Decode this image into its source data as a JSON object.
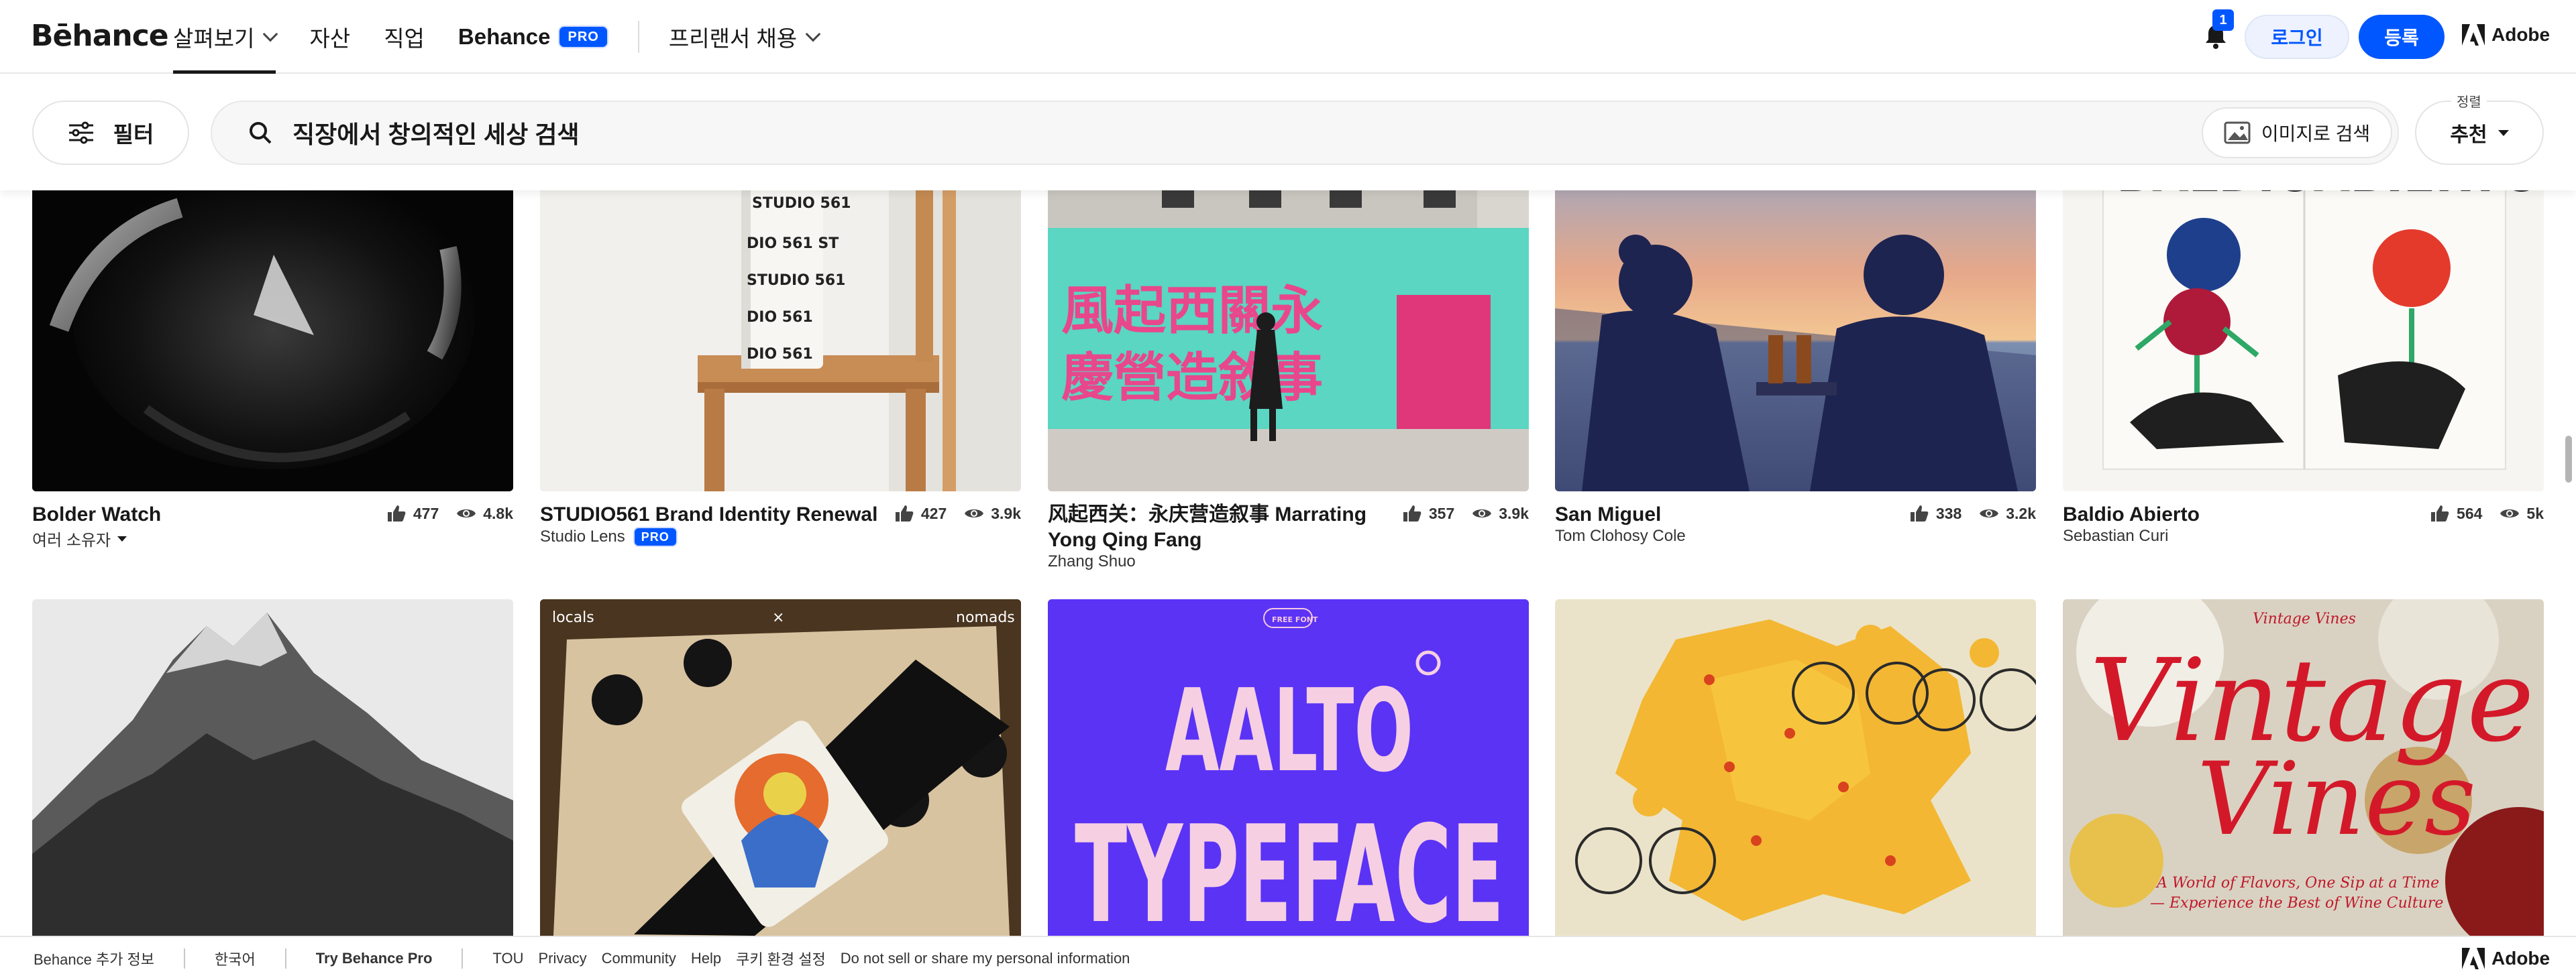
{
  "nav": {
    "logo": "Bēhance",
    "links": [
      "살펴보기",
      "자산",
      "직업"
    ],
    "behance_pro_label": "Behance",
    "pro_badge": "PRO",
    "freelance_label": "프리랜서 채용",
    "notification_count": "1",
    "login_label": "로그인",
    "signup_label": "등록",
    "adobe_label": "Adobe"
  },
  "search": {
    "filter_label": "필터",
    "value": "직장에서 창의적인 세상 검색",
    "image_search_label": "이미지로 검색",
    "sort_caption": "정렬",
    "sort_value": "추천"
  },
  "projects_row1": [
    {
      "title": "Bolder Watch",
      "owner": "여러 소유자",
      "owner_menu": true,
      "pro": false,
      "likes": "477",
      "views": "4.8k"
    },
    {
      "title": "STUDIO561 Brand Identity Renewal",
      "owner": "Studio Lens",
      "owner_menu": false,
      "pro": true,
      "pro_label": "PRO",
      "likes": "427",
      "views": "3.9k"
    },
    {
      "title_line1": "风起西关：永庆营造叙事 Marrating",
      "title_line2": "Yong Qing Fang",
      "owner": "Zhang Shuo",
      "likes": "357",
      "views": "3.9k"
    },
    {
      "title": "San Miguel",
      "owner": "Tom Clohosy Cole",
      "likes": "338",
      "views": "3.2k"
    },
    {
      "title": "Baldio Abierto",
      "owner": "Sebastian Curi",
      "likes": "564",
      "views": "5k"
    }
  ],
  "thumb_text": {
    "studio_bottle": "STUDIO 561",
    "poster_lines": [
      "風起西關永",
      "慶營造敘事"
    ],
    "baldio": "BALDIOABIERTO",
    "locals_left": "locals",
    "locals_x": "×",
    "locals_right": "nomads",
    "aalto_badge": "FREE FONT",
    "aalto_line1": "AALTO",
    "aalto_line2": "TYPEFACE",
    "vintage_top": "Vintage Vines",
    "vintage_big1": "Vintage",
    "vintage_big2": "Vines",
    "vintage_sub1": "A World of Flavors, One Sip at a Time",
    "vintage_sub2": "— Experience the Best of Wine Culture"
  },
  "footer": {
    "more_info": "Behance 추가 정보",
    "language": "한국어",
    "try_pro": "Try Behance Pro",
    "links": [
      "TOU",
      "Privacy",
      "Community",
      "Help",
      "쿠키 환경 설정",
      "Do not sell or share my personal information"
    ],
    "adobe_label": "Adobe"
  }
}
